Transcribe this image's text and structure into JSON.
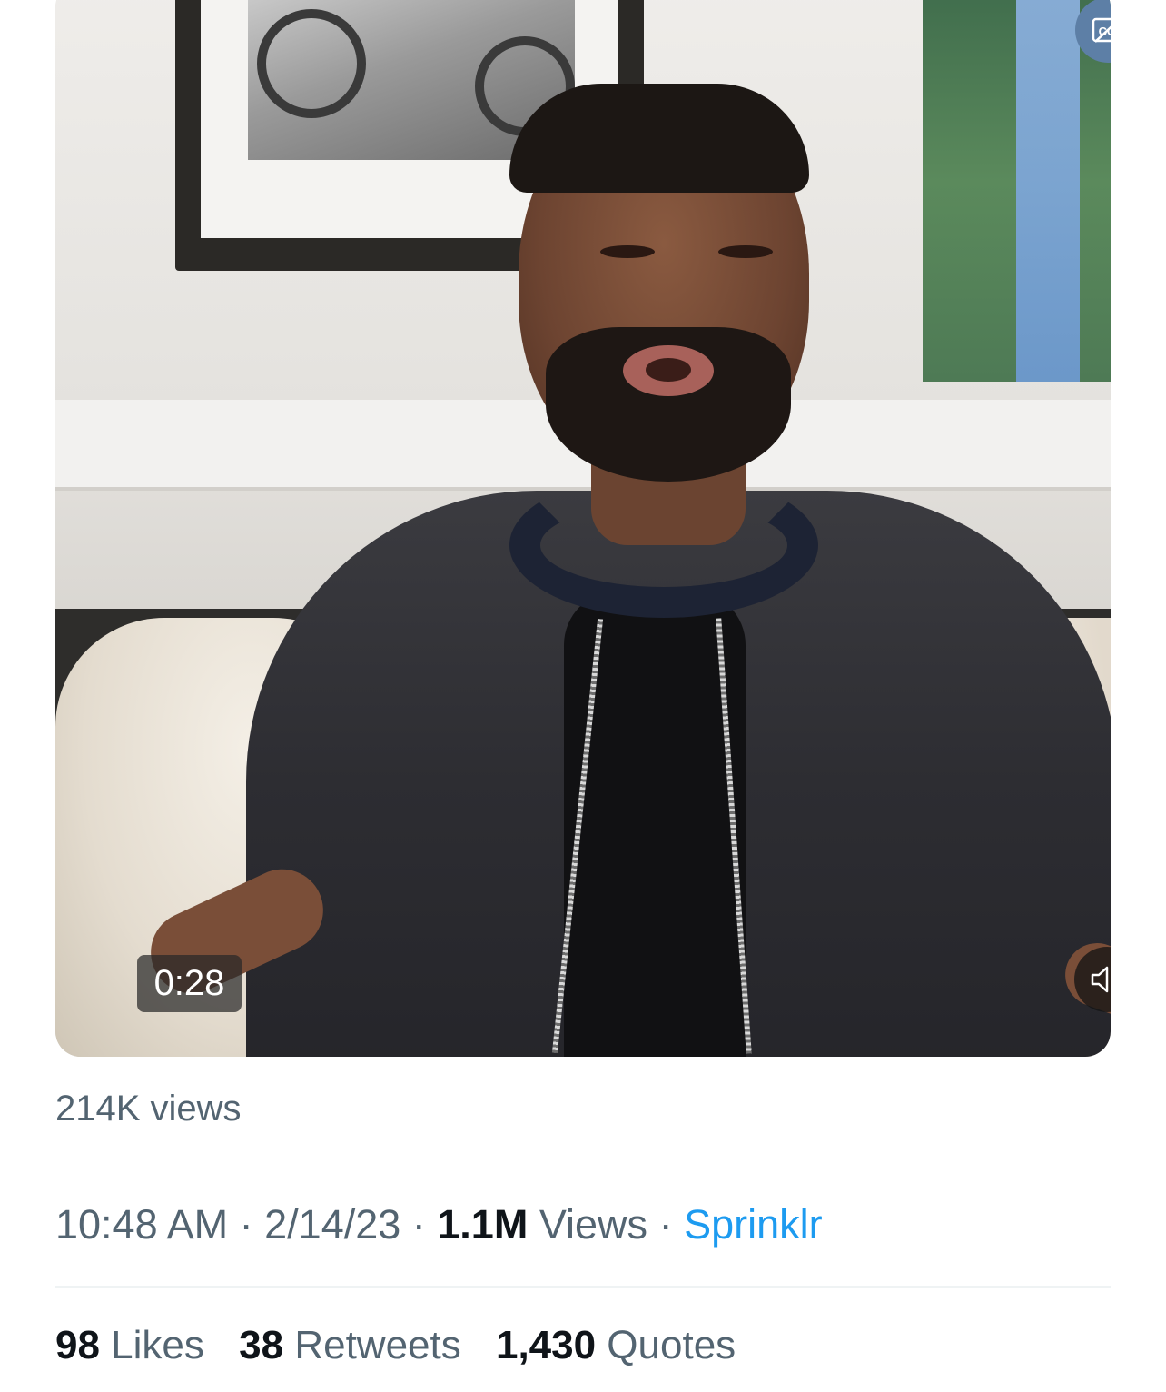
{
  "video": {
    "timer": "0:28",
    "captions_icon": "closed-captions-icon",
    "mute_icon": "volume-muted-icon"
  },
  "video_views": "214K views",
  "meta": {
    "time": "10:48 AM",
    "separator": " · ",
    "date": "2/14/23",
    "views_count": "1.1M",
    "views_label": " Views",
    "source": "Sprinklr"
  },
  "stats": {
    "likes_count": "98",
    "likes_label": " Likes",
    "retweets_count": "38",
    "retweets_label": " Retweets",
    "quotes_count": "1,430",
    "quotes_label": " Quotes"
  },
  "colors": {
    "link": "#1d9bf0",
    "primary_text": "#0f1419",
    "secondary_text": "#536471"
  }
}
